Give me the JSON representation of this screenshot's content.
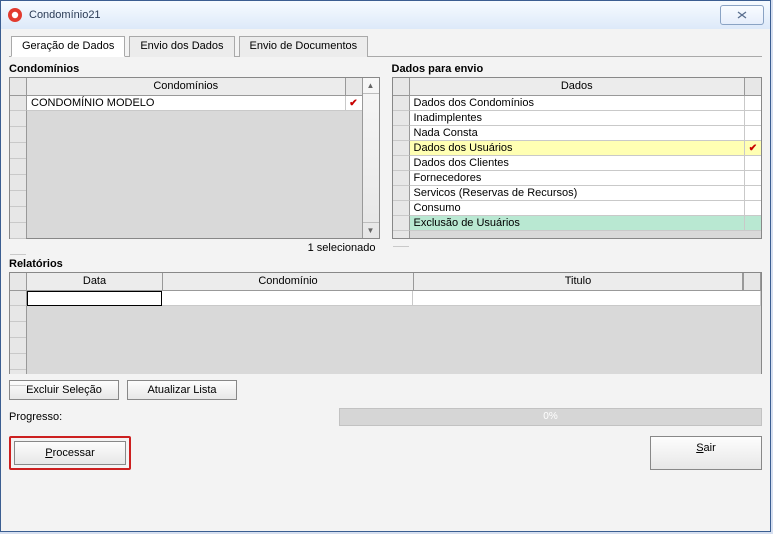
{
  "window": {
    "title": "Condomínio21"
  },
  "tabs": {
    "t1": "Geração de Dados",
    "t2": "Envio dos Dados",
    "t3": "Envio de Documentos"
  },
  "condominios": {
    "group_title": "Condomínios",
    "header": "Condomínios",
    "rows": [
      {
        "name": "CONDOMÍNIO MODELO",
        "checked": true
      }
    ],
    "selected_count_label": "1   selecionado"
  },
  "dados": {
    "group_title": "Dados para envio",
    "header": "Dados",
    "rows": [
      {
        "name": "Dados dos Condomínios",
        "checked": false,
        "hl": ""
      },
      {
        "name": "Inadimplentes",
        "checked": false,
        "hl": ""
      },
      {
        "name": "Nada Consta",
        "checked": false,
        "hl": ""
      },
      {
        "name": "Dados dos Usuários",
        "checked": true,
        "hl": "yellow"
      },
      {
        "name": "Dados dos Clientes",
        "checked": false,
        "hl": ""
      },
      {
        "name": "Fornecedores",
        "checked": false,
        "hl": ""
      },
      {
        "name": "Servicos (Reservas de Recursos)",
        "checked": false,
        "hl": ""
      },
      {
        "name": "Consumo",
        "checked": false,
        "hl": ""
      },
      {
        "name": "Exclusão de Usuários",
        "checked": false,
        "hl": "green"
      }
    ]
  },
  "relatorios": {
    "group_title": "Relatórios",
    "headers": {
      "c1": "Data",
      "c2": "Condomínio",
      "c3": "Titulo"
    }
  },
  "buttons": {
    "excluir": "Excluir Seleção",
    "atualizar": "Atualizar Lista",
    "processar": "Processar",
    "sair": "Sair"
  },
  "progress": {
    "label": "Progresso:",
    "value_text": "0%"
  }
}
